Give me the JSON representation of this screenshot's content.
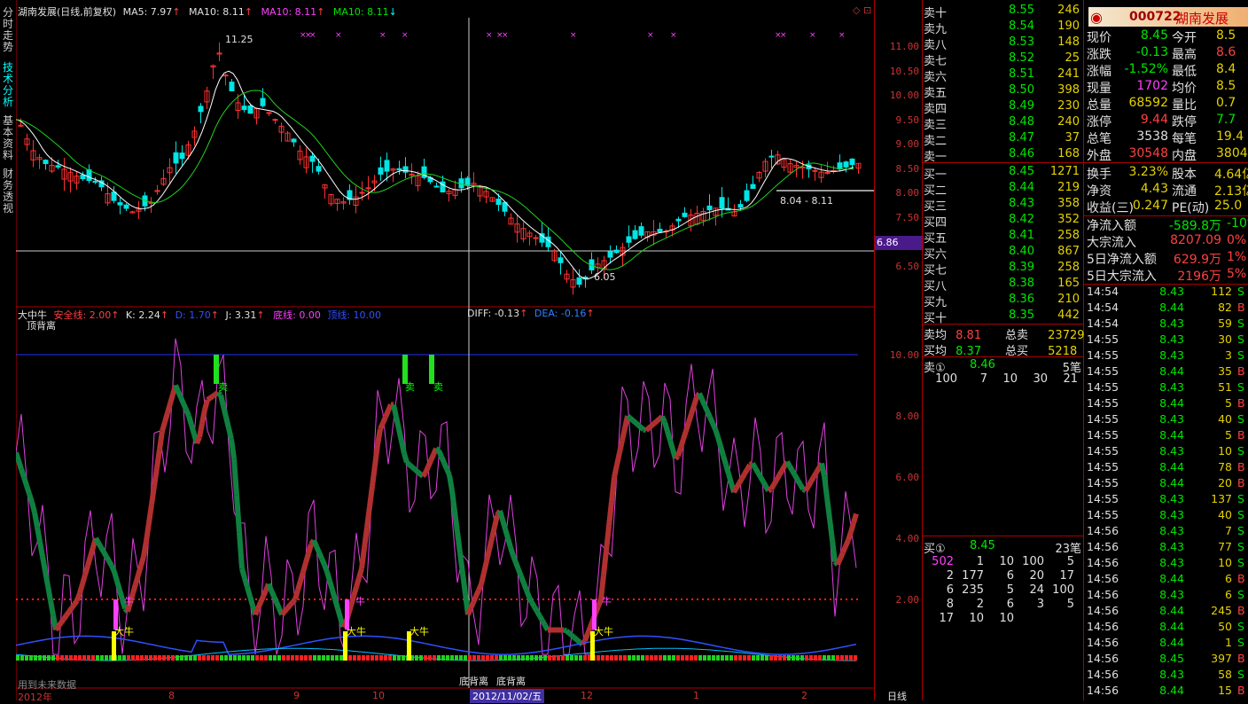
{
  "left_tabs": [
    {
      "label": "分时走势",
      "active": false
    },
    {
      "label": "技术分析",
      "active": true
    },
    {
      "label": "基本资料",
      "active": false
    },
    {
      "label": "财务透视",
      "active": false
    }
  ],
  "main_chart": {
    "title": "湖南发展(日线,前复权)",
    "ma5": "MA5: 7.97",
    "ma10a": "MA10: 8.11",
    "ma10b": "MA10: 8.11",
    "ma10c": "MA10: 8.11",
    "high_label": "11.25",
    "low_label": "6.05",
    "range_label": "8.04 - 8.11",
    "cursor_price": "6.86",
    "ticks": [
      "11.00",
      "10.50",
      "10.00",
      "9.50",
      "9.00",
      "8.50",
      "8.00",
      "7.50",
      "7.00",
      "6.50"
    ]
  },
  "indicator": {
    "name": "大中牛",
    "safe": "安全线: 2.00",
    "k": "K: 2.24",
    "d": "D: 1.70",
    "j": "J: 3.31",
    "bottom": "底线: 0.00",
    "top": "顶线: 10.00",
    "diff": "DIFF: -0.13",
    "dea": "DEA: -0.16",
    "sub_label": "顶背离",
    "sell": "卖",
    "big_bull": "大牛",
    "bull": "牛",
    "bottom_div": "底背离",
    "ticks": [
      "10.00",
      "8.00",
      "6.00",
      "4.00",
      "2.00"
    ],
    "future_note": "用到未来数据"
  },
  "x_axis": {
    "labels": [
      "2012年",
      "8",
      "9",
      "10",
      "11",
      "12",
      "1",
      "2"
    ],
    "cursor_date": "2012/11/02/五",
    "period": "日线"
  },
  "header": {
    "code": "000722",
    "name": "湖南发展"
  },
  "sell_orders": [
    {
      "label": "卖十",
      "price": "8.55",
      "vol": "246"
    },
    {
      "label": "卖九",
      "price": "8.54",
      "vol": "190"
    },
    {
      "label": "卖八",
      "price": "8.53",
      "vol": "148"
    },
    {
      "label": "卖七",
      "price": "8.52",
      "vol": "25"
    },
    {
      "label": "卖六",
      "price": "8.51",
      "vol": "241"
    },
    {
      "label": "卖五",
      "price": "8.50",
      "vol": "398"
    },
    {
      "label": "卖四",
      "price": "8.49",
      "vol": "230"
    },
    {
      "label": "卖三",
      "price": "8.48",
      "vol": "240"
    },
    {
      "label": "卖二",
      "price": "8.47",
      "vol": "37"
    },
    {
      "label": "卖一",
      "price": "8.46",
      "vol": "168"
    }
  ],
  "buy_orders": [
    {
      "label": "买一",
      "price": "8.45",
      "vol": "1271"
    },
    {
      "label": "买二",
      "price": "8.44",
      "vol": "219"
    },
    {
      "label": "买三",
      "price": "8.43",
      "vol": "358"
    },
    {
      "label": "买四",
      "price": "8.42",
      "vol": "352"
    },
    {
      "label": "买五",
      "price": "8.41",
      "vol": "258"
    },
    {
      "label": "买六",
      "price": "8.40",
      "vol": "867"
    },
    {
      "label": "买七",
      "price": "8.39",
      "vol": "258"
    },
    {
      "label": "买八",
      "price": "8.38",
      "vol": "165"
    },
    {
      "label": "买九",
      "price": "8.36",
      "vol": "210"
    },
    {
      "label": "买十",
      "price": "8.35",
      "vol": "442"
    }
  ],
  "avg": {
    "sell_avg_label": "卖均",
    "sell_avg": "8.81",
    "total_sell_label": "总卖",
    "total_sell": "23729",
    "buy_avg_label": "买均",
    "buy_avg": "8.37",
    "total_buy_label": "总买",
    "total_buy": "5218"
  },
  "sell1_queue": {
    "label": "卖①",
    "price": "8.46",
    "count": "5笔",
    "vols": [
      "100",
      "7",
      "10",
      "30",
      "21"
    ]
  },
  "buy1_queue": {
    "label": "买①",
    "price": "8.45",
    "count": "23笔",
    "rows": [
      [
        "502",
        "1",
        "10",
        "100",
        "5"
      ],
      [
        "2",
        "177",
        "6",
        "20",
        "17"
      ],
      [
        "6",
        "235",
        "5",
        "24",
        "100"
      ],
      [
        "8",
        "2",
        "6",
        "3",
        "5"
      ],
      [
        "17",
        "10",
        "10",
        "",
        ""
      ]
    ]
  },
  "quote": [
    {
      "l1": "现价",
      "v1": "8.45",
      "c1": "green",
      "l2": "今开",
      "v2": "8.5"
    },
    {
      "l1": "涨跌",
      "v1": "-0.13",
      "c1": "green",
      "l2": "最高",
      "v2": "8.6"
    },
    {
      "l1": "涨幅",
      "v1": "-1.52%",
      "c1": "green",
      "l2": "最低",
      "v2": "8.4"
    },
    {
      "l1": "现量",
      "v1": "1702",
      "c1": "magenta",
      "l2": "均价",
      "v2": "8.5"
    },
    {
      "l1": "总量",
      "v1": "68592",
      "c1": "yellow",
      "l2": "量比",
      "v2": "0.7"
    },
    {
      "l1": "涨停",
      "v1": "9.44",
      "c1": "red",
      "l2": "跌停",
      "v2": "7.7"
    },
    {
      "l1": "总笔",
      "v1": "3538",
      "c1": "white",
      "l2": "每笔",
      "v2": "19.4"
    },
    {
      "l1": "外盘",
      "v1": "30548",
      "c1": "red",
      "l2": "内盘",
      "v2": "3804"
    }
  ],
  "quote2": [
    {
      "l1": "换手",
      "v1": "3.23%",
      "l2": "股本",
      "v2": "4.64亿"
    },
    {
      "l1": "净资",
      "v1": "4.43",
      "l2": "流通",
      "v2": "2.13亿"
    },
    {
      "l1": "收益(三)",
      "v1": "0.247",
      "l2": "PE(动)",
      "v2": "25.0"
    }
  ],
  "flow": [
    {
      "l": "净流入额",
      "v": "-589.8万",
      "v2": "-10%",
      "c": "green"
    },
    {
      "l": "大宗流入",
      "v": "8207.09",
      "v2": "0%",
      "c": "red"
    },
    {
      "l": "5日净流入额",
      "v": "629.9万",
      "v2": "1%",
      "c": "red"
    },
    {
      "l": "5日大宗流入",
      "v": "2196万",
      "v2": "5%",
      "c": "red"
    }
  ],
  "ticks_list": [
    [
      "14:54",
      "8.43",
      "112",
      "S"
    ],
    [
      "14:54",
      "8.44",
      "82",
      "B"
    ],
    [
      "14:54",
      "8.43",
      "59",
      "S"
    ],
    [
      "14:55",
      "8.43",
      "30",
      "S"
    ],
    [
      "14:55",
      "8.43",
      "3",
      "S"
    ],
    [
      "14:55",
      "8.44",
      "35",
      "B"
    ],
    [
      "14:55",
      "8.43",
      "51",
      "S"
    ],
    [
      "14:55",
      "8.44",
      "5",
      "B"
    ],
    [
      "14:55",
      "8.43",
      "40",
      "S"
    ],
    [
      "14:55",
      "8.44",
      "5",
      "B"
    ],
    [
      "14:55",
      "8.43",
      "10",
      "S"
    ],
    [
      "14:55",
      "8.44",
      "78",
      "B"
    ],
    [
      "14:55",
      "8.44",
      "20",
      "B"
    ],
    [
      "14:55",
      "8.43",
      "137",
      "S"
    ],
    [
      "14:55",
      "8.43",
      "40",
      "S"
    ],
    [
      "14:56",
      "8.43",
      "7",
      "S"
    ],
    [
      "14:56",
      "8.43",
      "77",
      "S"
    ],
    [
      "14:56",
      "8.43",
      "10",
      "S"
    ],
    [
      "14:56",
      "8.44",
      "6",
      "B"
    ],
    [
      "14:56",
      "8.43",
      "6",
      "S"
    ],
    [
      "14:56",
      "8.44",
      "245",
      "B"
    ],
    [
      "14:56",
      "8.44",
      "50",
      "S"
    ],
    [
      "14:56",
      "8.44",
      "1",
      "S"
    ],
    [
      "14:56",
      "8.45",
      "397",
      "B"
    ],
    [
      "14:56",
      "8.43",
      "58",
      "S"
    ],
    [
      "14:56",
      "8.44",
      "15",
      "B"
    ]
  ]
}
